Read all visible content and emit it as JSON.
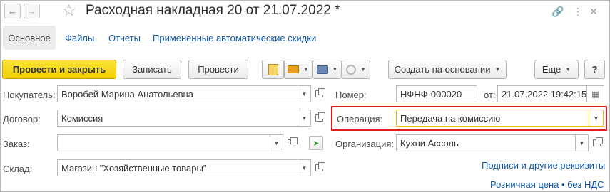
{
  "window": {
    "title": "Расходная накладная 20 от 21.07.2022 *"
  },
  "tabs": [
    {
      "label": "Основное"
    },
    {
      "label": "Файлы"
    },
    {
      "label": "Отчеты"
    },
    {
      "label": "Примененные автоматические скидки"
    }
  ],
  "toolbar": {
    "post_close": "Провести и закрыть",
    "save": "Записать",
    "post": "Провести",
    "create_based_on": "Создать на основании",
    "more": "Еще",
    "help": "?"
  },
  "fields": {
    "buyer": {
      "label": "Покупатель:",
      "value": "Воробей Марина Анатольевна"
    },
    "contract": {
      "label": "Договор:",
      "value": "Комиссия"
    },
    "order": {
      "label": "Заказ:",
      "value": ""
    },
    "warehouse": {
      "label": "Склад:",
      "value": "Магазин \"Хозяйственные товары\""
    },
    "number": {
      "label": "Номер:",
      "value": "НФНФ-000020"
    },
    "date": {
      "label": "от:",
      "value": "21.07.2022 19:42:15"
    },
    "operation": {
      "label": "Операция:",
      "value": "Передача на комиссию"
    },
    "organization": {
      "label": "Организация:",
      "value": "Кухни Ассоль"
    }
  },
  "links": {
    "signatures": "Подписи и другие реквизиты",
    "price": "Розничная цена • без НДС"
  },
  "colors": {
    "primary_button": "#f5d20a",
    "link": "#0f57a8",
    "highlight": "#e11d1d"
  }
}
